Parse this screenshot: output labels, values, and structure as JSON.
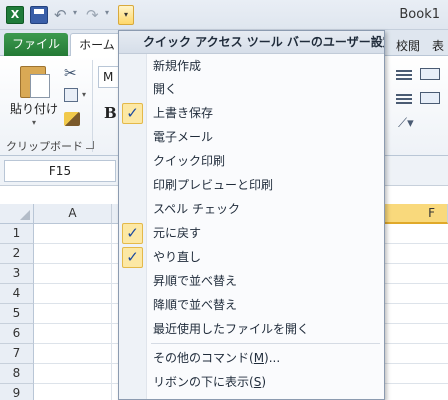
{
  "window": {
    "title": "Book1"
  },
  "qat": {
    "excel_icon": "excel-app-icon",
    "save_icon": "save-icon",
    "undo_icon": "undo-icon",
    "redo_icon": "redo-icon",
    "customize_glyph": "▾"
  },
  "tabs": {
    "file": "ファイル",
    "home": "ホーム",
    "review": "校閲",
    "view": "表"
  },
  "ribbon": {
    "paste_label": "貼り付け",
    "font_name": "M",
    "bold": "B",
    "clipboard_group": "クリップボード"
  },
  "formula_bar": {
    "name_box": "F15"
  },
  "grid": {
    "columns": [
      "A",
      "F"
    ],
    "selected_column": "F",
    "rows": [
      "1",
      "2",
      "3",
      "4",
      "5",
      "6",
      "7",
      "8",
      "9"
    ]
  },
  "menu": {
    "header": "クイック アクセス ツール バーのユーザー設定",
    "items": [
      {
        "label": "新規作成",
        "checked": false
      },
      {
        "label": "開く",
        "checked": false
      },
      {
        "label": "上書き保存",
        "checked": true
      },
      {
        "label": "電子メール",
        "checked": false
      },
      {
        "label": "クイック印刷",
        "checked": false
      },
      {
        "label": "印刷プレビューと印刷",
        "checked": false
      },
      {
        "label": "スペル チェック",
        "checked": false
      },
      {
        "label": "元に戻す",
        "checked": true
      },
      {
        "label": "やり直し",
        "checked": true
      },
      {
        "label": "昇順で並べ替え",
        "checked": false
      },
      {
        "label": "降順で並べ替え",
        "checked": false
      },
      {
        "label": "最近使用したファイルを開く",
        "checked": false
      }
    ],
    "more_commands": {
      "text": "その他のコマンド(",
      "mnemonic": "M",
      "suffix": ")..."
    },
    "show_below": {
      "text": "リボンの下に表示(",
      "mnemonic": "S",
      "suffix": ")"
    },
    "check_glyph": "✓"
  },
  "colors": {
    "file_tab": "#247a36",
    "highlight": "#fce8a4",
    "selected_col": "#f9d97c"
  }
}
